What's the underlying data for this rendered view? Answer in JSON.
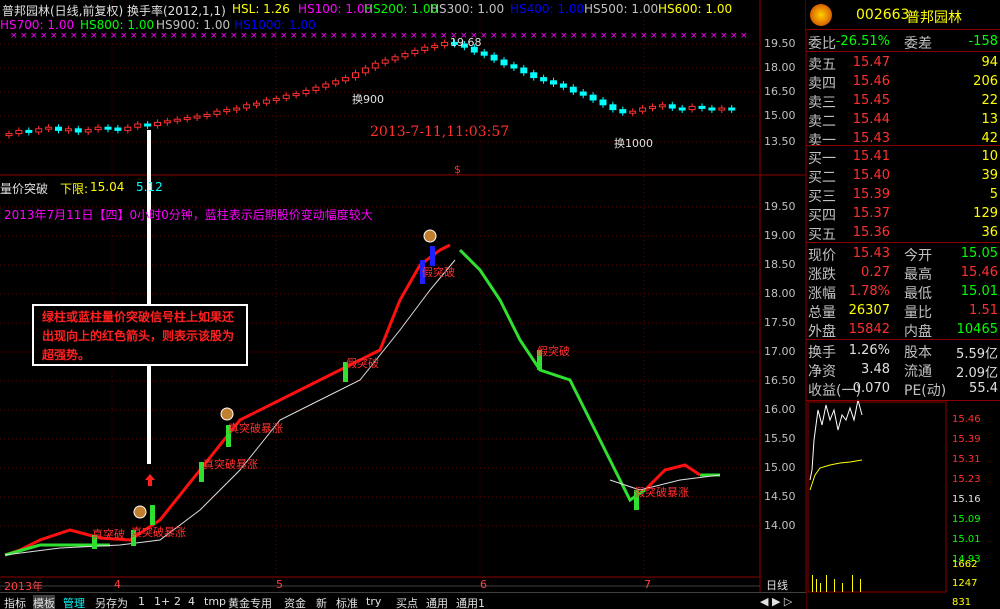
{
  "header": {
    "title": "普邦园林(日线,前复权) 换手率(2012,1,1)"
  },
  "ma_legend": [
    {
      "label": "HSL: 1.26",
      "color": "#ffff00"
    },
    {
      "label": "HS100: 1.00",
      "color": "#ff00ff"
    },
    {
      "label": "HS200: 1.00",
      "color": "#00ff00"
    },
    {
      "label": "HS300: 1.00",
      "color": "#c0c0c0"
    },
    {
      "label": "HS400: 1.00",
      "color": "#0000ff"
    },
    {
      "label": "HS500: 1.00",
      "color": "#c0c0c0"
    },
    {
      "label": "HS600: 1.00",
      "color": "#ffff00"
    },
    {
      "label": "HS700: 1.00",
      "color": "#ff00ff"
    },
    {
      "label": "HS800: 1.00",
      "color": "#00ff00"
    },
    {
      "label": "HS900: 1.00",
      "color": "#c0c0c0"
    },
    {
      "label": "HS1000: 1.00",
      "color": "#0000ff"
    }
  ],
  "upper_chart": {
    "y_ticks": [
      "19.50",
      "18.00",
      "16.50",
      "15.00",
      "13.50"
    ],
    "annotations": {
      "peak": "19.68",
      "label_900": "换900",
      "label_1000": "换1000"
    },
    "timestamp": "2013-7-11,11:03:57",
    "dollar": "$"
  },
  "indicator": {
    "name": "量价突破",
    "lower_label": "下限:",
    "lower_value": "15.04",
    "upper_value": "5.12",
    "description": "2013年7月11日【四】0小时0分钟，蓝柱表示后期股价变动幅度较大",
    "y_ticks": [
      "19.50",
      "19.00",
      "18.50",
      "18.00",
      "17.50",
      "17.00",
      "16.50",
      "16.00",
      "15.50",
      "15.00",
      "14.50",
      "14.00"
    ],
    "signals": [
      "真突破",
      "真突破暴涨",
      "假突破",
      "真突破暴涨",
      "真突破暴涨",
      "假突破",
      "假突破",
      "假突破暴涨"
    ],
    "annotation": "绿柱或蓝柱量价突破信号柱上如果还出现向上的红色箭头，则表示该股为超强势。"
  },
  "x_axis": {
    "labels": [
      "2013年",
      "4",
      "5",
      "6",
      "7"
    ]
  },
  "quote": {
    "code": "002663",
    "name": "普邦园林",
    "weibi": {
      "label": "委比",
      "value": "-26.51%",
      "label2": "委差",
      "value2": "-158"
    },
    "sells": [
      {
        "label": "卖五",
        "price": "15.47",
        "vol": "94"
      },
      {
        "label": "卖四",
        "price": "15.46",
        "vol": "206"
      },
      {
        "label": "卖三",
        "price": "15.45",
        "vol": "22"
      },
      {
        "label": "卖二",
        "price": "15.44",
        "vol": "13"
      },
      {
        "label": "卖一",
        "price": "15.43",
        "vol": "42"
      }
    ],
    "buys": [
      {
        "label": "买一",
        "price": "15.41",
        "vol": "10"
      },
      {
        "label": "买二",
        "price": "15.40",
        "vol": "39"
      },
      {
        "label": "买三",
        "price": "15.39",
        "vol": "5"
      },
      {
        "label": "买四",
        "price": "15.37",
        "vol": "129"
      },
      {
        "label": "买五",
        "price": "15.36",
        "vol": "36"
      }
    ],
    "stats": [
      {
        "l1": "现价",
        "v1": "15.43",
        "c1": "#ff3030",
        "l2": "今开",
        "v2": "15.05",
        "c2": "#00ff00"
      },
      {
        "l1": "涨跌",
        "v1": "0.27",
        "c1": "#ff3030",
        "l2": "最高",
        "v2": "15.46",
        "c2": "#ff3030"
      },
      {
        "l1": "涨幅",
        "v1": "1.78%",
        "c1": "#ff3030",
        "l2": "最低",
        "v2": "15.01",
        "c2": "#00ff00"
      },
      {
        "l1": "总量",
        "v1": "26307",
        "c1": "#ffff00",
        "l2": "量比",
        "v2": "1.51",
        "c2": "#ff3030"
      },
      {
        "l1": "外盘",
        "v1": "15842",
        "c1": "#ff3030",
        "l2": "内盘",
        "v2": "10465",
        "c2": "#00ff00"
      }
    ],
    "stats2": [
      {
        "l1": "换手",
        "v1": "1.26%",
        "l2": "股本",
        "v2": "5.59亿"
      },
      {
        "l1": "净资",
        "v1": "3.48",
        "l2": "流通",
        "v2": "2.09亿"
      },
      {
        "l1": "收益(一)",
        "v1": "0.070",
        "l2": "PE(动)",
        "v2": "55.4"
      }
    ],
    "mini_y": [
      "15.46",
      "15.39",
      "15.31",
      "15.23",
      "15.16",
      "15.09",
      "15.01",
      "14.93"
    ],
    "mini_vol": [
      "1662",
      "1247",
      "831"
    ]
  },
  "toolbar": {
    "day_label": "日线",
    "tabs": [
      "指标",
      "模板",
      "管理",
      "另存为",
      "1",
      "1+",
      "2",
      "4",
      "tmp",
      "黄金专用",
      "资金",
      "新",
      "标准",
      "try",
      "买点",
      "通用",
      "通用1"
    ]
  }
}
